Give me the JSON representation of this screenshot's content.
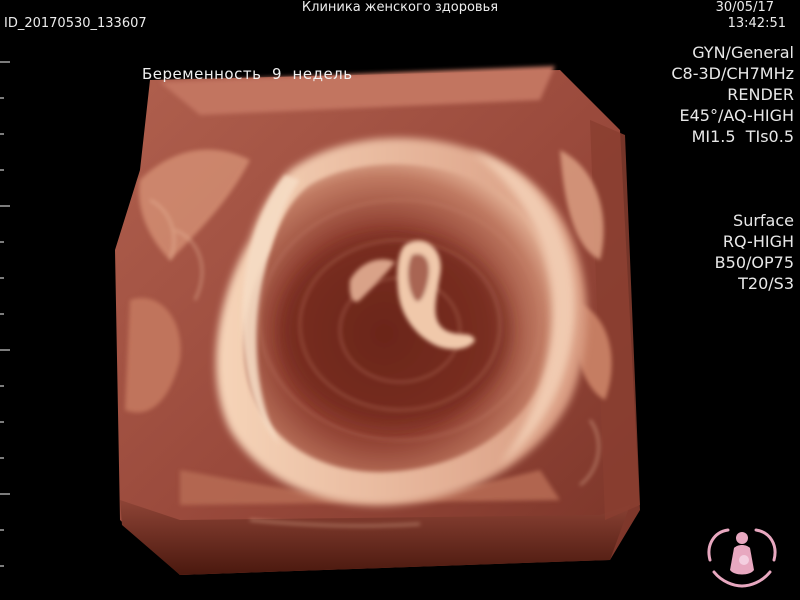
{
  "header": {
    "clinic_name": "Клиника женского здоровья",
    "patient_id": "ID_20170530_133607",
    "date": "30/05/17",
    "time": "13:42:51"
  },
  "acquisition": {
    "lines": [
      "GYN/General",
      "C8-3D/CH7MHz",
      "RENDER",
      "E45°/AQ-HIGH",
      "MI1.5  TIs0.5"
    ]
  },
  "render_settings": {
    "lines": [
      "Surface",
      "RQ-HIGH",
      "B50/OP75",
      "T20/S3"
    ]
  },
  "annotation": {
    "caption": "Беременность  9  недель"
  },
  "colors": {
    "tissue": "#a8554a",
    "highlight": "#f2c4a6",
    "shadow": "#3a1208",
    "logo": "#e8a8c0"
  },
  "icons": [
    "logo-mother-child-icon"
  ]
}
